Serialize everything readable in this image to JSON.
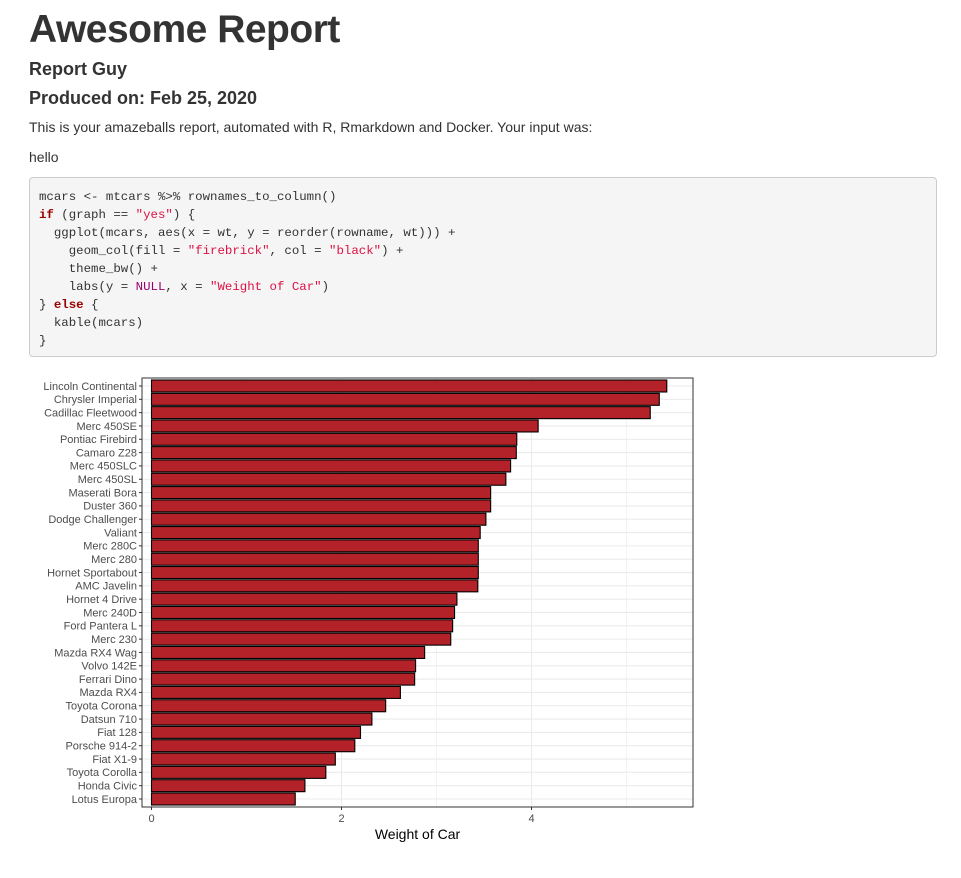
{
  "report": {
    "title": "Awesome Report",
    "author": "Report Guy",
    "date": "Produced on: Feb 25, 2020",
    "intro": "This is your amazeballs report, automated with R, Rmarkdown and Docker. Your input was:",
    "input": "hello"
  },
  "code_lines": [
    [
      {
        "t": "mcars <- mtcars %>% rownames_to_column()",
        "c": "plain"
      }
    ],
    [
      {
        "t": "if",
        "c": "kw"
      },
      {
        "t": " (graph == ",
        "c": "plain"
      },
      {
        "t": "\"yes\"",
        "c": "str"
      },
      {
        "t": ") {",
        "c": "plain"
      }
    ],
    [
      {
        "t": "  ggplot(mcars, aes(x = wt, y = reorder(rowname, wt))) +",
        "c": "plain"
      }
    ],
    [
      {
        "t": "    geom_col(fill = ",
        "c": "plain"
      },
      {
        "t": "\"firebrick\"",
        "c": "str"
      },
      {
        "t": ", col = ",
        "c": "plain"
      },
      {
        "t": "\"black\"",
        "c": "str"
      },
      {
        "t": ") +",
        "c": "plain"
      }
    ],
    [
      {
        "t": "    theme_bw() +",
        "c": "plain"
      }
    ],
    [
      {
        "t": "    labs(y = ",
        "c": "plain"
      },
      {
        "t": "NULL",
        "c": "cst"
      },
      {
        "t": ", x = ",
        "c": "plain"
      },
      {
        "t": "\"Weight of Car\"",
        "c": "str"
      },
      {
        "t": ")",
        "c": "plain"
      }
    ],
    [
      {
        "t": "} ",
        "c": "plain"
      },
      {
        "t": "else",
        "c": "kw"
      },
      {
        "t": " {",
        "c": "plain"
      }
    ],
    [
      {
        "t": "  kable(mcars)",
        "c": "plain"
      }
    ],
    [
      {
        "t": "}",
        "c": "plain"
      }
    ]
  ],
  "chart_data": {
    "type": "bar",
    "orientation": "horizontal",
    "xlabel": "Weight of Car",
    "ylabel": "",
    "xlim": [
      -0.1,
      5.7
    ],
    "xticks": [
      0,
      2,
      4
    ],
    "grid": true,
    "bar_fill": "#b22228",
    "bar_border": "#000000",
    "categories": [
      "Lincoln Continental",
      "Chrysler Imperial",
      "Cadillac Fleetwood",
      "Merc 450SE",
      "Pontiac Firebird",
      "Camaro Z28",
      "Merc 450SLC",
      "Merc 450SL",
      "Maserati Bora",
      "Duster 360",
      "Dodge Challenger",
      "Valiant",
      "Merc 280C",
      "Merc 280",
      "Hornet Sportabout",
      "AMC Javelin",
      "Hornet 4 Drive",
      "Merc 240D",
      "Ford Pantera L",
      "Merc 230",
      "Mazda RX4 Wag",
      "Volvo 142E",
      "Ferrari Dino",
      "Mazda RX4",
      "Toyota Corona",
      "Datsun 710",
      "Fiat 128",
      "Porsche 914-2",
      "Fiat X1-9",
      "Toyota Corolla",
      "Honda Civic",
      "Lotus Europa"
    ],
    "values": [
      5.424,
      5.345,
      5.25,
      4.07,
      3.845,
      3.84,
      3.78,
      3.73,
      3.57,
      3.57,
      3.52,
      3.46,
      3.44,
      3.44,
      3.44,
      3.435,
      3.215,
      3.19,
      3.17,
      3.15,
      2.875,
      2.78,
      2.77,
      2.62,
      2.465,
      2.32,
      2.2,
      2.14,
      1.935,
      1.835,
      1.615,
      1.513
    ]
  }
}
